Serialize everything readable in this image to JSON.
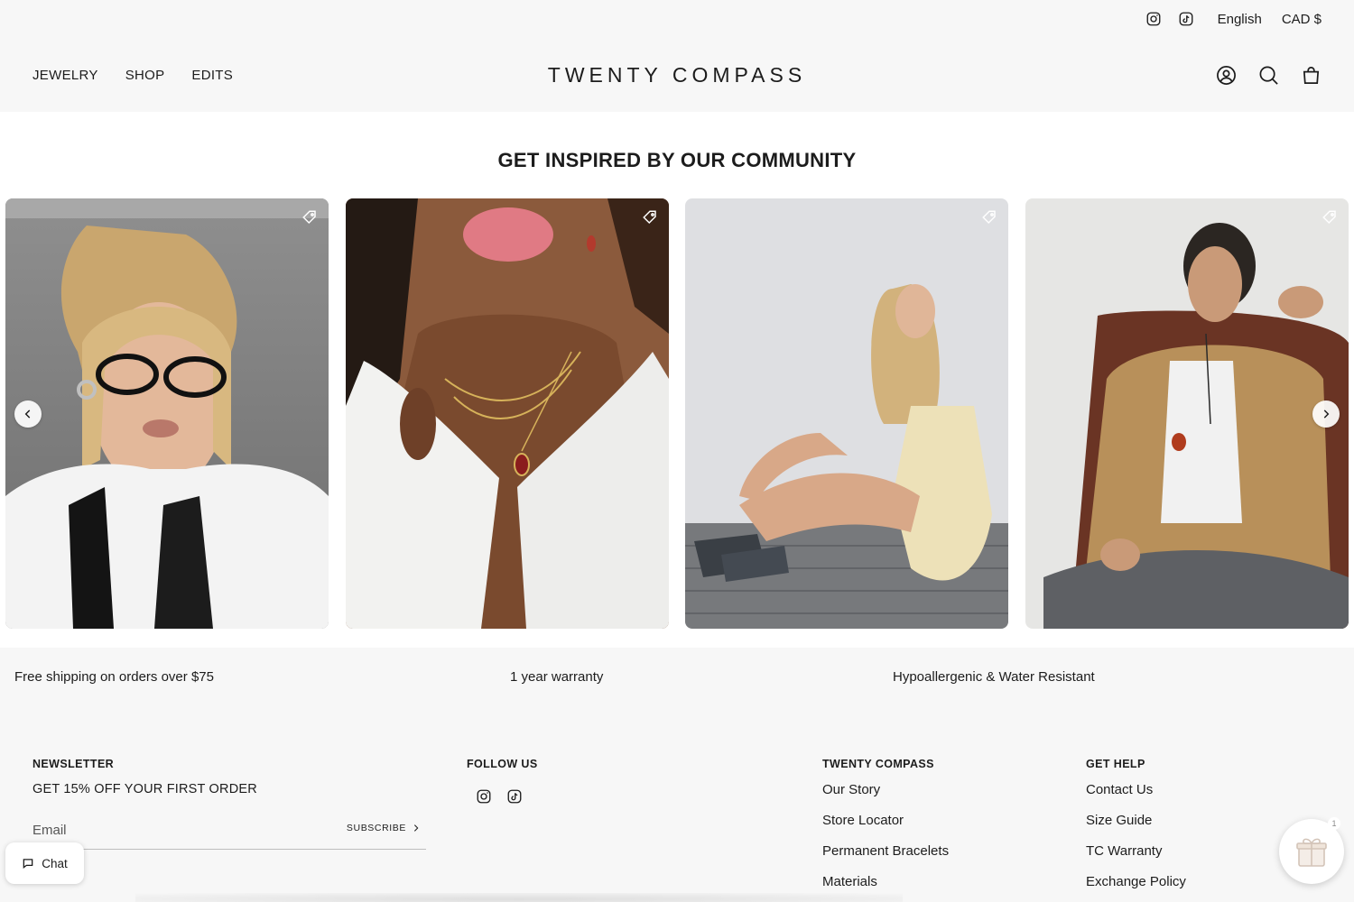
{
  "topbar": {
    "language": "English",
    "currency": "CAD $"
  },
  "header": {
    "nav": [
      "JEWELRY",
      "SHOP",
      "EDITS"
    ],
    "logo": "TWENTY COMPASS"
  },
  "community": {
    "title": "GET INSPIRED BY OUR COMMUNITY"
  },
  "perks": [
    "Free shipping on orders over $75",
    "1 year warranty",
    "Hypoallergenic & Water Resistant"
  ],
  "footer": {
    "newsletter": {
      "title": "NEWSLETTER",
      "subtitle": "GET 15% OFF YOUR FIRST ORDER",
      "placeholder": "Email",
      "subscribe_label": "SUBSCRIBE"
    },
    "follow": {
      "title": "FOLLOW US"
    },
    "brand": {
      "title": "TWENTY COMPASS",
      "links": [
        "Our Story",
        "Store Locator",
        "Permanent Bracelets",
        "Materials"
      ]
    },
    "help": {
      "title": "GET HELP",
      "links": [
        "Contact Us",
        "Size Guide",
        "TC Warranty",
        "Exchange Policy"
      ]
    }
  },
  "chat": {
    "label": "Chat"
  },
  "gift": {
    "badge": "1"
  }
}
